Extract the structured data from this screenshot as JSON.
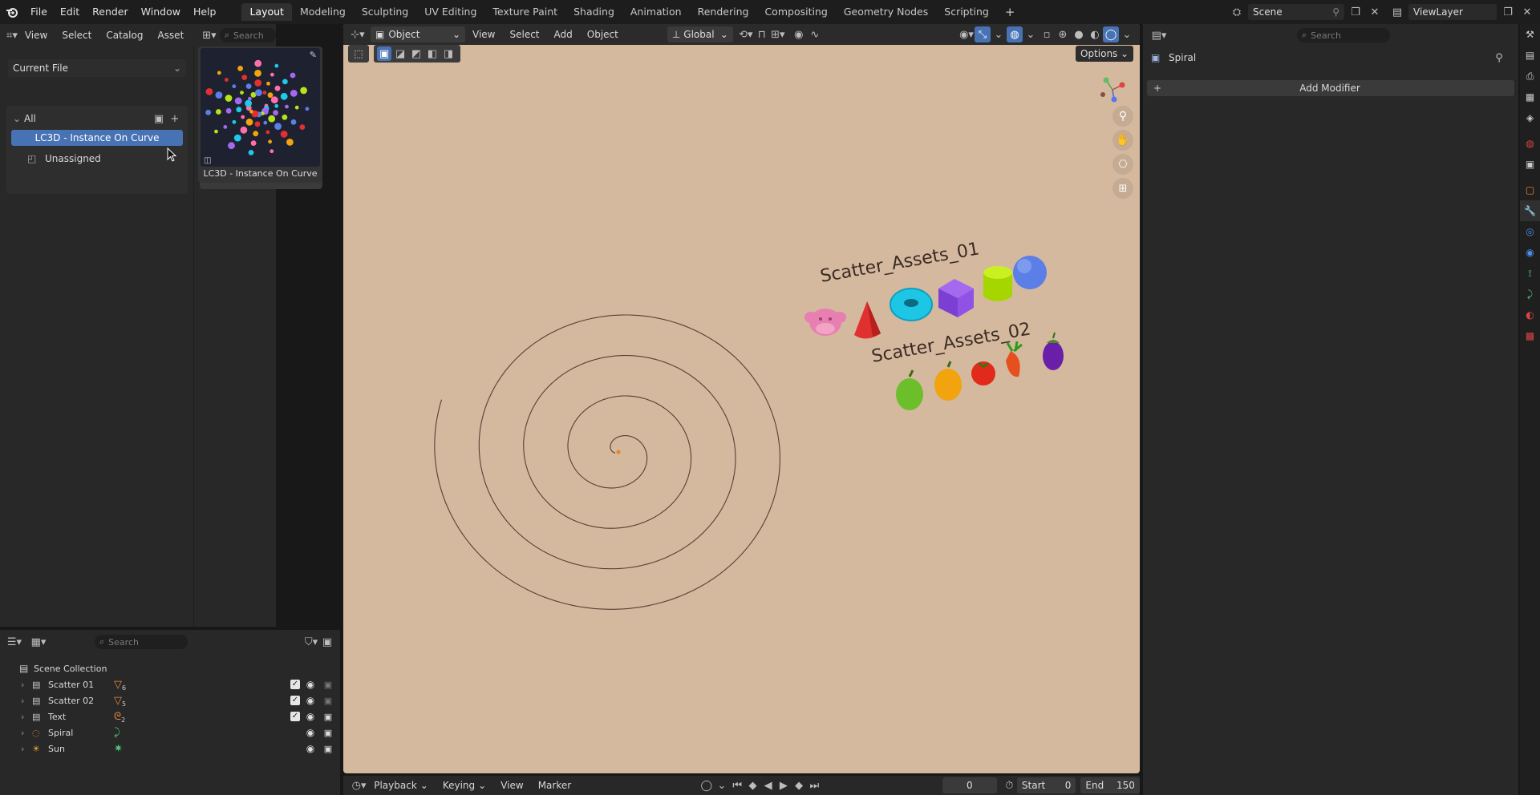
{
  "topbar": {
    "menus": [
      "File",
      "Edit",
      "Render",
      "Window",
      "Help"
    ],
    "workspaces": [
      "Layout",
      "Modeling",
      "Sculpting",
      "UV Editing",
      "Texture Paint",
      "Shading",
      "Animation",
      "Rendering",
      "Compositing",
      "Geometry Nodes",
      "Scripting"
    ],
    "add_tab": "+",
    "scene": "Scene",
    "view_layer": "ViewLayer"
  },
  "asset_browser": {
    "menus": [
      "View",
      "Select",
      "Catalog",
      "Asset"
    ],
    "search_placeholder": "Search",
    "library": "Current File",
    "catalog_root": "All",
    "catalogs": [
      "LC3D - Instance On Curve",
      "Unassigned"
    ],
    "asset_name": "LC3D - Instance On Curve"
  },
  "viewport": {
    "mode": "Object Mode",
    "menus": [
      "View",
      "Select",
      "Add",
      "Object"
    ],
    "orientation": "Global",
    "options": "Options",
    "text1": "Scatter_Assets_01",
    "text2": "Scatter_Assets_02",
    "bg_color": "#d4b99f"
  },
  "properties": {
    "search_placeholder": "Search",
    "object_name": "Spiral",
    "add_modifier": "Add Modifier"
  },
  "outliner": {
    "search_placeholder": "Search",
    "root": "Scene Collection",
    "items": [
      {
        "name": "Scatter 01",
        "badge": "6"
      },
      {
        "name": "Scatter 02",
        "badge": "5"
      },
      {
        "name": "Text",
        "badge": "2"
      },
      {
        "name": "Spiral",
        "badge": ""
      },
      {
        "name": "Sun",
        "badge": ""
      }
    ]
  },
  "timeline": {
    "menus": [
      "Playback",
      "Keying",
      "View",
      "Marker"
    ],
    "current_frame": "0",
    "start_label": "Start",
    "start": "0",
    "end_label": "End",
    "end": "150"
  },
  "colors": {
    "accent": "#4772b3",
    "spiral": "#5a3e32"
  }
}
